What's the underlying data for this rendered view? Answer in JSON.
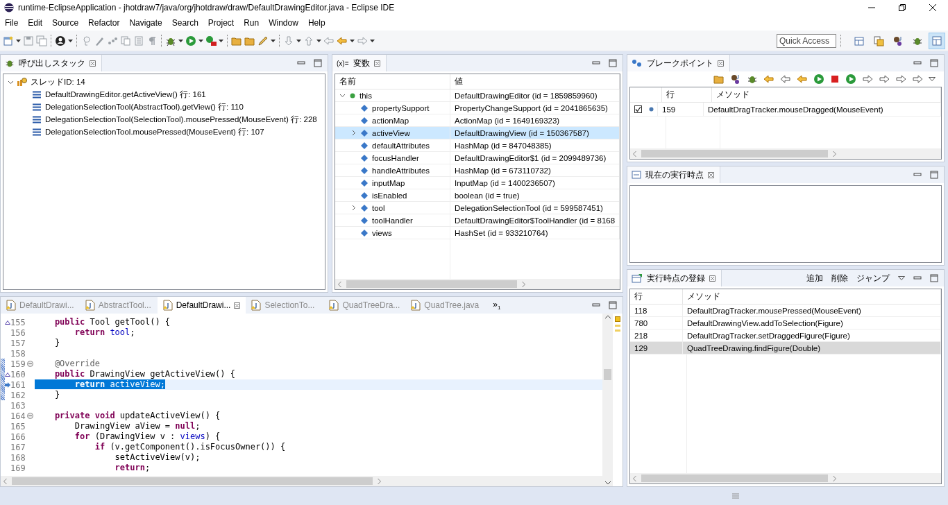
{
  "window": {
    "title": "runtime-EclipseApplication - jhotdraw7/java/org/jhotdraw/draw/DefaultDrawingEditor.java - Eclipse IDE"
  },
  "menu": [
    "File",
    "Edit",
    "Source",
    "Refactor",
    "Navigate",
    "Search",
    "Project",
    "Run",
    "Window",
    "Help"
  ],
  "toolbar": [
    {
      "kind": "new",
      "disabled": false,
      "dropdown": true
    },
    {
      "kind": "save",
      "disabled": true,
      "dropdown": false
    },
    {
      "kind": "save-all",
      "disabled": true,
      "dropdown": false
    },
    {
      "kind": "separator"
    },
    {
      "kind": "person",
      "disabled": false,
      "dropdown": true
    },
    {
      "kind": "separator"
    },
    {
      "kind": "bulb",
      "disabled": true,
      "dropdown": false
    },
    {
      "kind": "pen",
      "disabled": true,
      "dropdown": false
    },
    {
      "kind": "steps",
      "disabled": true,
      "dropdown": false
    },
    {
      "kind": "copy",
      "disabled": true,
      "dropdown": false
    },
    {
      "kind": "doc",
      "disabled": true,
      "dropdown": false
    },
    {
      "kind": "pilcrow",
      "disabled": true,
      "dropdown": false
    },
    {
      "kind": "separator"
    },
    {
      "kind": "bug",
      "disabled": false,
      "dropdown": true
    },
    {
      "kind": "run",
      "disabled": false,
      "dropdown": true
    },
    {
      "kind": "external",
      "disabled": false,
      "dropdown": true
    },
    {
      "kind": "separator"
    },
    {
      "kind": "open-folder",
      "disabled": false,
      "dropdown": false
    },
    {
      "kind": "folder",
      "disabled": false,
      "dropdown": false
    },
    {
      "kind": "pencil",
      "disabled": false,
      "dropdown": true
    },
    {
      "kind": "separator"
    },
    {
      "kind": "next-mark",
      "disabled": true,
      "dropdown": true
    },
    {
      "kind": "prev-mark",
      "disabled": true,
      "dropdown": true
    },
    {
      "kind": "last-edit",
      "disabled": true,
      "dropdown": false
    },
    {
      "kind": "back",
      "disabled": false,
      "dropdown": true
    },
    {
      "kind": "forward",
      "disabled": true,
      "dropdown": true
    }
  ],
  "quick_access": {
    "placeholder": "Quick Access"
  },
  "perspectives": [
    {
      "kind": "open",
      "selected": false
    },
    {
      "kind": "resource",
      "selected": false
    },
    {
      "kind": "java",
      "selected": false
    },
    {
      "kind": "debug",
      "selected": false
    },
    {
      "kind": "layout",
      "selected": true
    }
  ],
  "call_stack": {
    "title": "呼び出しスタック",
    "thread": {
      "label": "スレッドID: 14",
      "expanded": true,
      "children": [
        {
          "label": "DefaultDrawingEditor.getActiveView() 行: 161"
        },
        {
          "label": "DelegationSelectionTool(AbstractTool).getView() 行: 110"
        },
        {
          "label": "DelegationSelectionTool(SelectionTool).mousePressed(MouseEvent) 行: 228"
        },
        {
          "label": "DelegationSelectionTool.mousePressed(MouseEvent) 行: 107"
        }
      ]
    }
  },
  "variables": {
    "title": "変数",
    "title_prefix": "(x)=",
    "columns": [
      "名前",
      "値"
    ],
    "rows": [
      {
        "name": "this",
        "value": "DefaultDrawingEditor (id = 1859859960)",
        "kind": "local",
        "expandable": true,
        "expanded": true,
        "selected": false,
        "children": [
          {
            "name": "propertySupport",
            "value": "PropertyChangeSupport (id = 2041865635)",
            "kind": "field",
            "expandable": false,
            "selected": false
          },
          {
            "name": "actionMap",
            "value": "ActionMap (id = 1649169323)",
            "kind": "field",
            "expandable": false,
            "selected": false
          },
          {
            "name": "activeView",
            "value": "DefaultDrawingView (id = 150367587)",
            "kind": "field",
            "expandable": true,
            "expanded": false,
            "selected": true
          },
          {
            "name": "defaultAttributes",
            "value": "HashMap (id = 847048385)",
            "kind": "field",
            "expandable": false,
            "selected": false
          },
          {
            "name": "focusHandler",
            "value": "DefaultDrawingEditor$1 (id = 2099489736)",
            "kind": "field",
            "expandable": false,
            "selected": false
          },
          {
            "name": "handleAttributes",
            "value": "HashMap (id = 673110732)",
            "kind": "field",
            "expandable": false,
            "selected": false
          },
          {
            "name": "inputMap",
            "value": "InputMap (id = 1400236507)",
            "kind": "field",
            "expandable": false,
            "selected": false
          },
          {
            "name": "isEnabled",
            "value": "boolean (id = true)",
            "kind": "field",
            "expandable": false,
            "selected": false
          },
          {
            "name": "tool",
            "value": "DelegationSelectionTool (id = 599587451)",
            "kind": "field",
            "expandable": true,
            "expanded": false,
            "selected": false
          },
          {
            "name": "toolHandler",
            "value": "DefaultDrawingEditor$ToolHandler (id = 8168",
            "kind": "field",
            "expandable": false,
            "selected": false
          },
          {
            "name": "views",
            "value": "HashSet (id = 933210764)",
            "kind": "field",
            "expandable": false,
            "selected": false
          }
        ]
      }
    ]
  },
  "editor": {
    "tabs": [
      {
        "label": "DefaultDrawi...",
        "selected": false
      },
      {
        "label": "AbstractTool...",
        "selected": false
      },
      {
        "label": "DefaultDrawi...",
        "selected": true
      },
      {
        "label": "SelectionTo...",
        "selected": false
      },
      {
        "label": "QuadTreeDra...",
        "selected": false
      },
      {
        "label": "QuadTree.java",
        "selected": false
      }
    ],
    "overflow": "»",
    "overflow_count": "1",
    "lines": [
      {
        "number": "155",
        "override": true,
        "breakpoint": false,
        "fold": false,
        "current": false,
        "segments": [
          {
            "kind": "kw",
            "text": "    public"
          },
          {
            "kind": "plain",
            "text": " Tool getTool() {"
          }
        ]
      },
      {
        "number": "156",
        "override": false,
        "breakpoint": false,
        "fold": false,
        "current": false,
        "segments": [
          {
            "kind": "kw",
            "text": "        return"
          },
          {
            "kind": "field",
            "text": " tool"
          },
          {
            "kind": "plain",
            "text": ";"
          }
        ]
      },
      {
        "number": "157",
        "override": false,
        "breakpoint": false,
        "fold": false,
        "current": false,
        "segments": [
          {
            "kind": "plain",
            "text": "    }"
          }
        ]
      },
      {
        "number": "158",
        "override": false,
        "breakpoint": false,
        "fold": false,
        "current": false
      },
      {
        "number": "159",
        "override": false,
        "breakpoint": true,
        "fold": true,
        "current": false,
        "segments": [
          {
            "kind": "ann",
            "text": "    @Override"
          }
        ]
      },
      {
        "number": "160",
        "override": true,
        "breakpoint": true,
        "fold": false,
        "current": false,
        "segments": [
          {
            "kind": "kw",
            "text": "    public"
          },
          {
            "kind": "plain",
            "text": " DrawingView getActiveView() {"
          }
        ]
      },
      {
        "number": "161",
        "override": false,
        "breakpoint": true,
        "fold": false,
        "current": true,
        "segments": [
          {
            "kind": "kw",
            "text": "        return"
          },
          {
            "kind": "plain",
            "text": " activeView;"
          }
        ]
      },
      {
        "number": "162",
        "override": false,
        "breakpoint": true,
        "fold": false,
        "current": false,
        "segments": [
          {
            "kind": "plain",
            "text": "    }"
          }
        ]
      },
      {
        "number": "163",
        "override": false,
        "breakpoint": false,
        "fold": false,
        "current": false
      },
      {
        "number": "164",
        "override": false,
        "breakpoint": false,
        "fold": true,
        "current": false,
        "segments": [
          {
            "kind": "kw",
            "text": "    private"
          },
          {
            "kind": "kw",
            "text": " void"
          },
          {
            "kind": "plain",
            "text": " updateActiveView() {"
          }
        ]
      },
      {
        "number": "165",
        "override": false,
        "breakpoint": false,
        "fold": false,
        "current": false,
        "segments": [
          {
            "kind": "plain",
            "text": "        DrawingView aView = "
          },
          {
            "kind": "kw",
            "text": "null"
          },
          {
            "kind": "plain",
            "text": ";"
          }
        ]
      },
      {
        "number": "166",
        "override": false,
        "breakpoint": false,
        "fold": false,
        "current": false,
        "segments": [
          {
            "kind": "kw",
            "text": "        for"
          },
          {
            "kind": "plain",
            "text": " (DrawingView v : "
          },
          {
            "kind": "field",
            "text": "views"
          },
          {
            "kind": "plain",
            "text": ") {"
          }
        ]
      },
      {
        "number": "167",
        "override": false,
        "breakpoint": false,
        "fold": false,
        "current": false,
        "segments": [
          {
            "kind": "kw",
            "text": "            if"
          },
          {
            "kind": "plain",
            "text": " (v.getComponent().isFocusOwner()) {"
          }
        ]
      },
      {
        "number": "168",
        "override": false,
        "breakpoint": false,
        "fold": false,
        "current": false,
        "segments": [
          {
            "kind": "plain",
            "text": "                setActiveView(v);"
          }
        ]
      },
      {
        "number": "169",
        "override": false,
        "breakpoint": false,
        "fold": false,
        "current": false,
        "segments": [
          {
            "kind": "kw",
            "text": "                return"
          },
          {
            "kind": "plain",
            "text": ";"
          }
        ]
      }
    ]
  },
  "breakpoints": {
    "title": "ブレークポイント",
    "columns": [
      "行",
      "メソッド"
    ],
    "rows": [
      {
        "checked": true,
        "line": "159",
        "method": "DefaultDragTracker.mouseDragged(MouseEvent)"
      }
    ]
  },
  "current_point": {
    "title": "現在の実行時点"
  },
  "registered_points": {
    "title": "実行時点の登録",
    "actions": [
      "追加",
      "削除",
      "ジャンプ"
    ],
    "columns": [
      "行",
      "メソッド"
    ],
    "rows": [
      {
        "line": "118",
        "method": "DefaultDragTracker.mousePressed(MouseEvent)",
        "selected": false
      },
      {
        "line": "780",
        "method": "DefaultDrawingView.addToSelection(Figure)",
        "selected": false
      },
      {
        "line": "218",
        "method": "DefaultDragTracker.setDraggedFigure(Figure)",
        "selected": false
      },
      {
        "line": "129",
        "method": "QuadTreeDrawing.findFigure(Double)",
        "selected": true
      }
    ]
  }
}
